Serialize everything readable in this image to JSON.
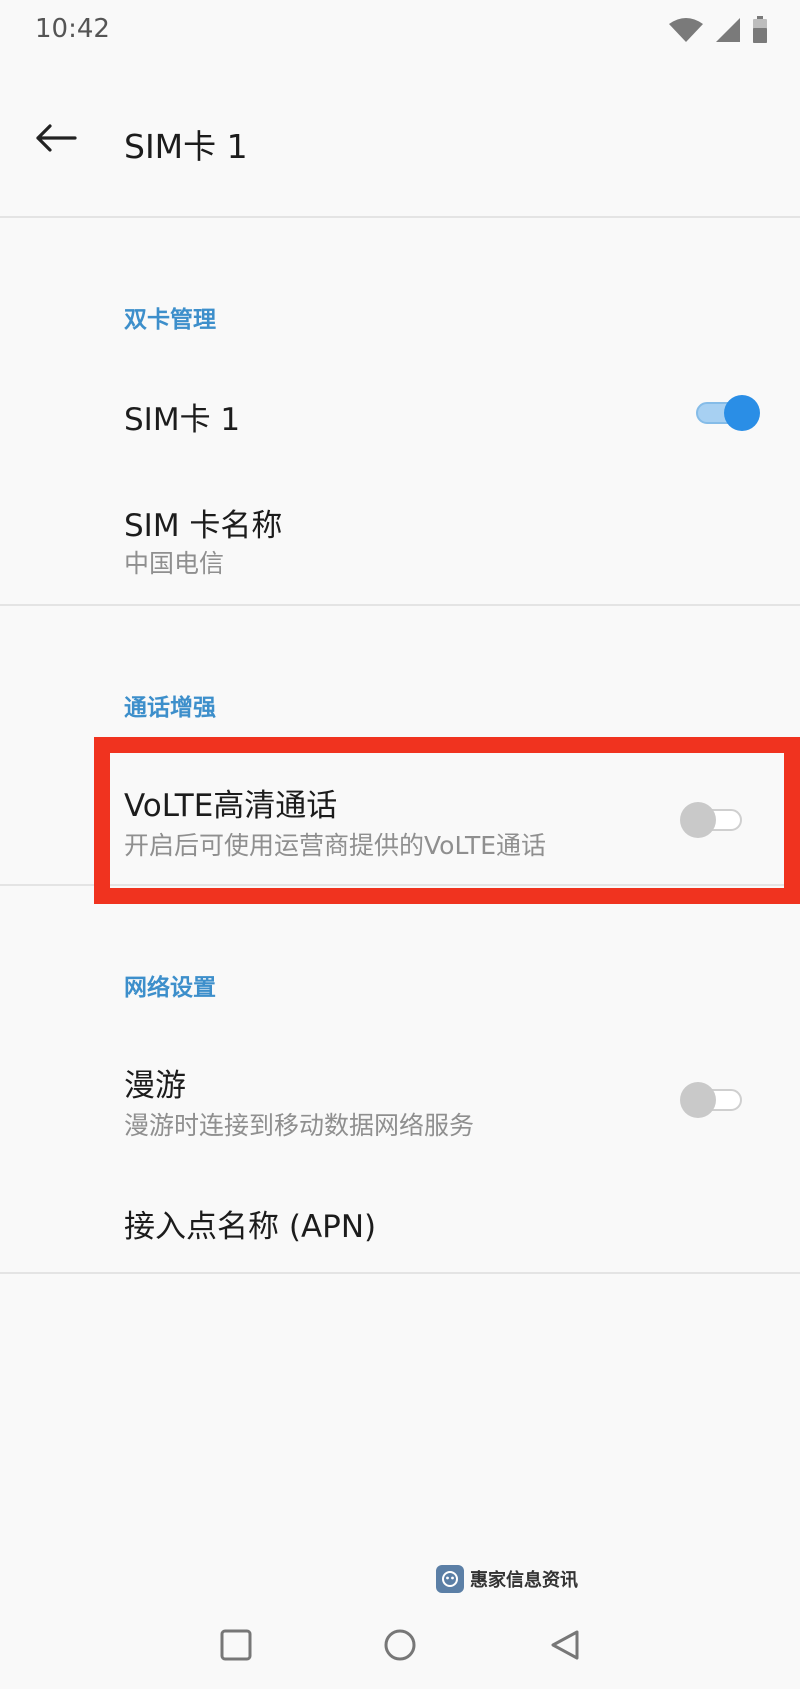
{
  "status_bar": {
    "time": "10:42",
    "icons": [
      "wifi-icon",
      "cell-signal-icon",
      "battery-icon"
    ]
  },
  "toolbar": {
    "back_icon": "arrow-back-icon",
    "title": "SIM卡 1"
  },
  "sections": {
    "dual_sim": {
      "header": "双卡管理",
      "sim_toggle": {
        "title": "SIM卡 1",
        "enabled": true
      },
      "sim_name": {
        "title": "SIM 卡名称",
        "summary": "中国电信"
      }
    },
    "call_enhance": {
      "header": "通话增强",
      "volte": {
        "title": "VoLTE高清通话",
        "summary": "开启后可使用运营商提供的VoLTE通话",
        "enabled": false
      }
    },
    "network": {
      "header": "网络设置",
      "roaming": {
        "title": "漫游",
        "summary": "漫游时连接到移动数据网络服务",
        "enabled": false
      },
      "apn": {
        "title": "接入点名称 (APN)"
      }
    }
  },
  "watermark": {
    "text": "惠家信息资讯"
  },
  "nav_bar": {
    "buttons": [
      "recents-square-icon",
      "home-circle-icon",
      "back-triangle-icon"
    ]
  },
  "colors": {
    "accent": "#2a8ee6",
    "section_header": "#3d8fcb",
    "highlight": "#f0331f"
  }
}
